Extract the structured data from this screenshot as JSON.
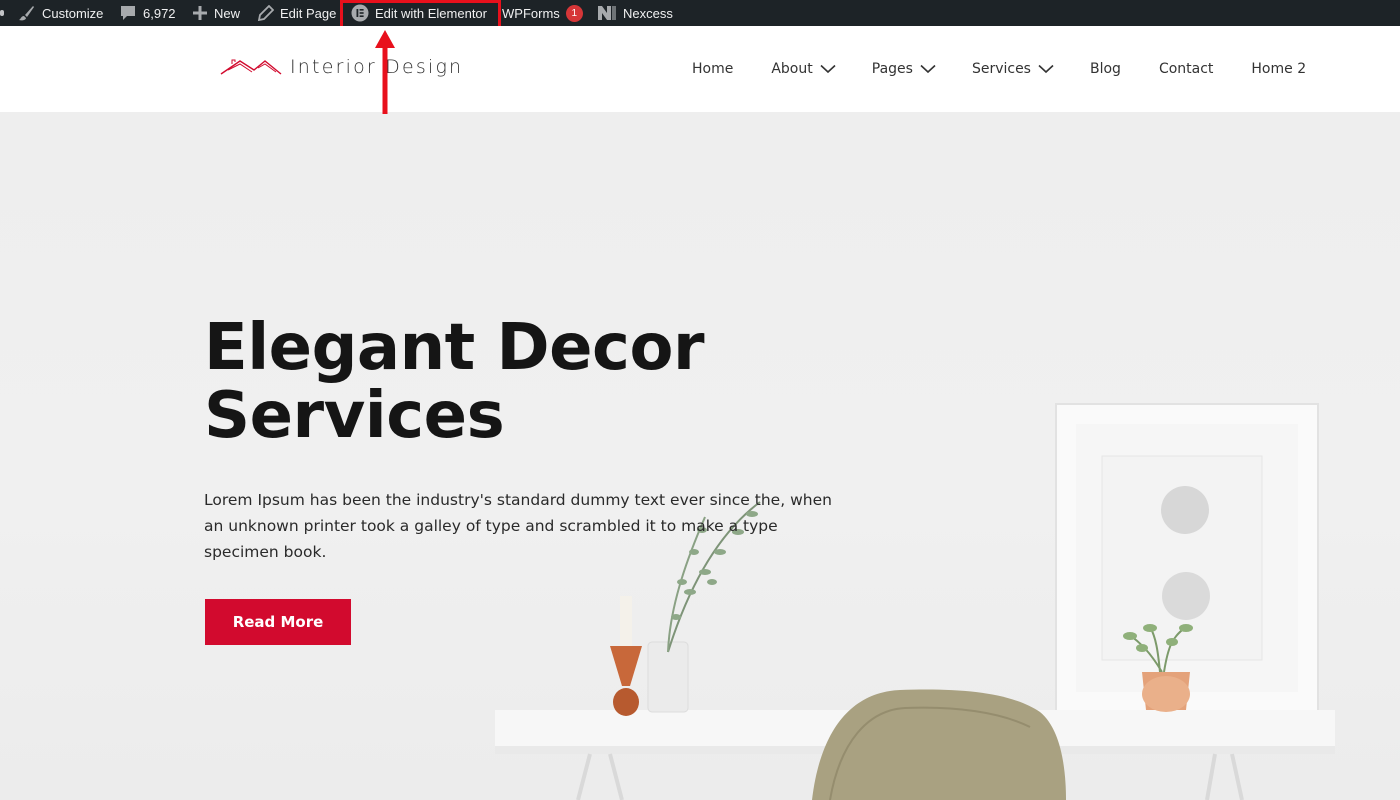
{
  "adminbar": {
    "customize_label": "Customize",
    "comments_count": "6,972",
    "new_label": "New",
    "edit_page_label": "Edit Page",
    "elementor_label": "Edit with Elementor",
    "wpforms_label": "WPForms",
    "wpforms_badge": "1",
    "nexcess_label": "Nexcess"
  },
  "header": {
    "logo_text": "Interior Design",
    "nav": [
      {
        "label": "Home"
      },
      {
        "label": "About"
      },
      {
        "label": "Pages"
      },
      {
        "label": "Services"
      },
      {
        "label": "Blog"
      },
      {
        "label": "Contact"
      },
      {
        "label": "Home 2"
      }
    ]
  },
  "hero": {
    "title_line1": "Elegant Decor",
    "title_line2": "Services",
    "text": "Lorem Ipsum has been the industry's standard dummy text ever since the, when an unknown printer took a galley of type and scrambled it to make a type specimen book.",
    "button_label": "Read More"
  },
  "colors": {
    "admin_bar": "#1d2327",
    "accent": "#d20a2e",
    "highlight": "#e8101c"
  }
}
